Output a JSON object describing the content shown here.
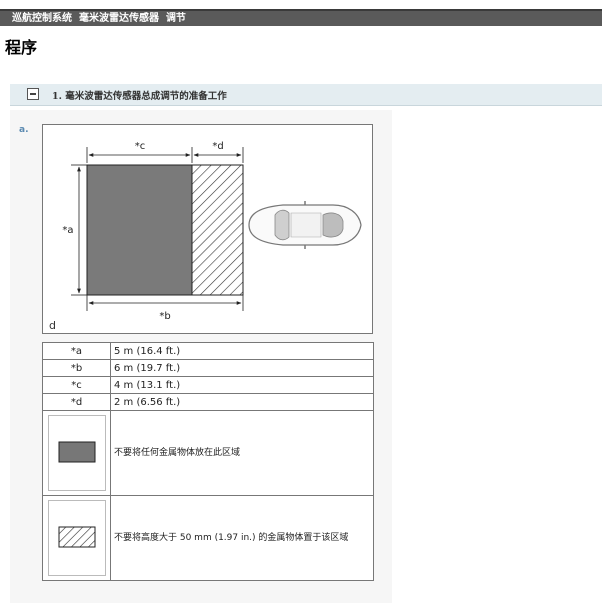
{
  "breadcrumb": "巡航控制系统  毫米波雷达传感器  调节",
  "page_title": "程序",
  "section": {
    "title": "1. 毫米波雷达传感器总成调节的准备工作"
  },
  "step": {
    "label": "a.",
    "figure": {
      "dim_labels": {
        "a": "*a",
        "b": "*b",
        "c": "*c",
        "d": "*d"
      },
      "corner_mark": "d"
    },
    "specs": [
      {
        "key": "*a",
        "value": "5 m (16.4 ft.)"
      },
      {
        "key": "*b",
        "value": "6 m (19.7 ft.)"
      },
      {
        "key": "*c",
        "value": "4 m (13.1 ft.)"
      },
      {
        "key": "*d",
        "value": "2 m (6.56 ft.)"
      }
    ],
    "legend": [
      {
        "icon": "solid-gray-area-icon",
        "text": "不要将任何金属物体放在此区域"
      },
      {
        "icon": "hatched-area-icon",
        "text": "不要将高度大于 50 mm (1.97 in.) 的金属物体置于该区域"
      }
    ]
  },
  "colors": {
    "breadcrumb_bg": "#5a5a5a",
    "section_bg": "#e4edf1",
    "step_label": "#5b8ab1",
    "solid_area": "#777777"
  }
}
